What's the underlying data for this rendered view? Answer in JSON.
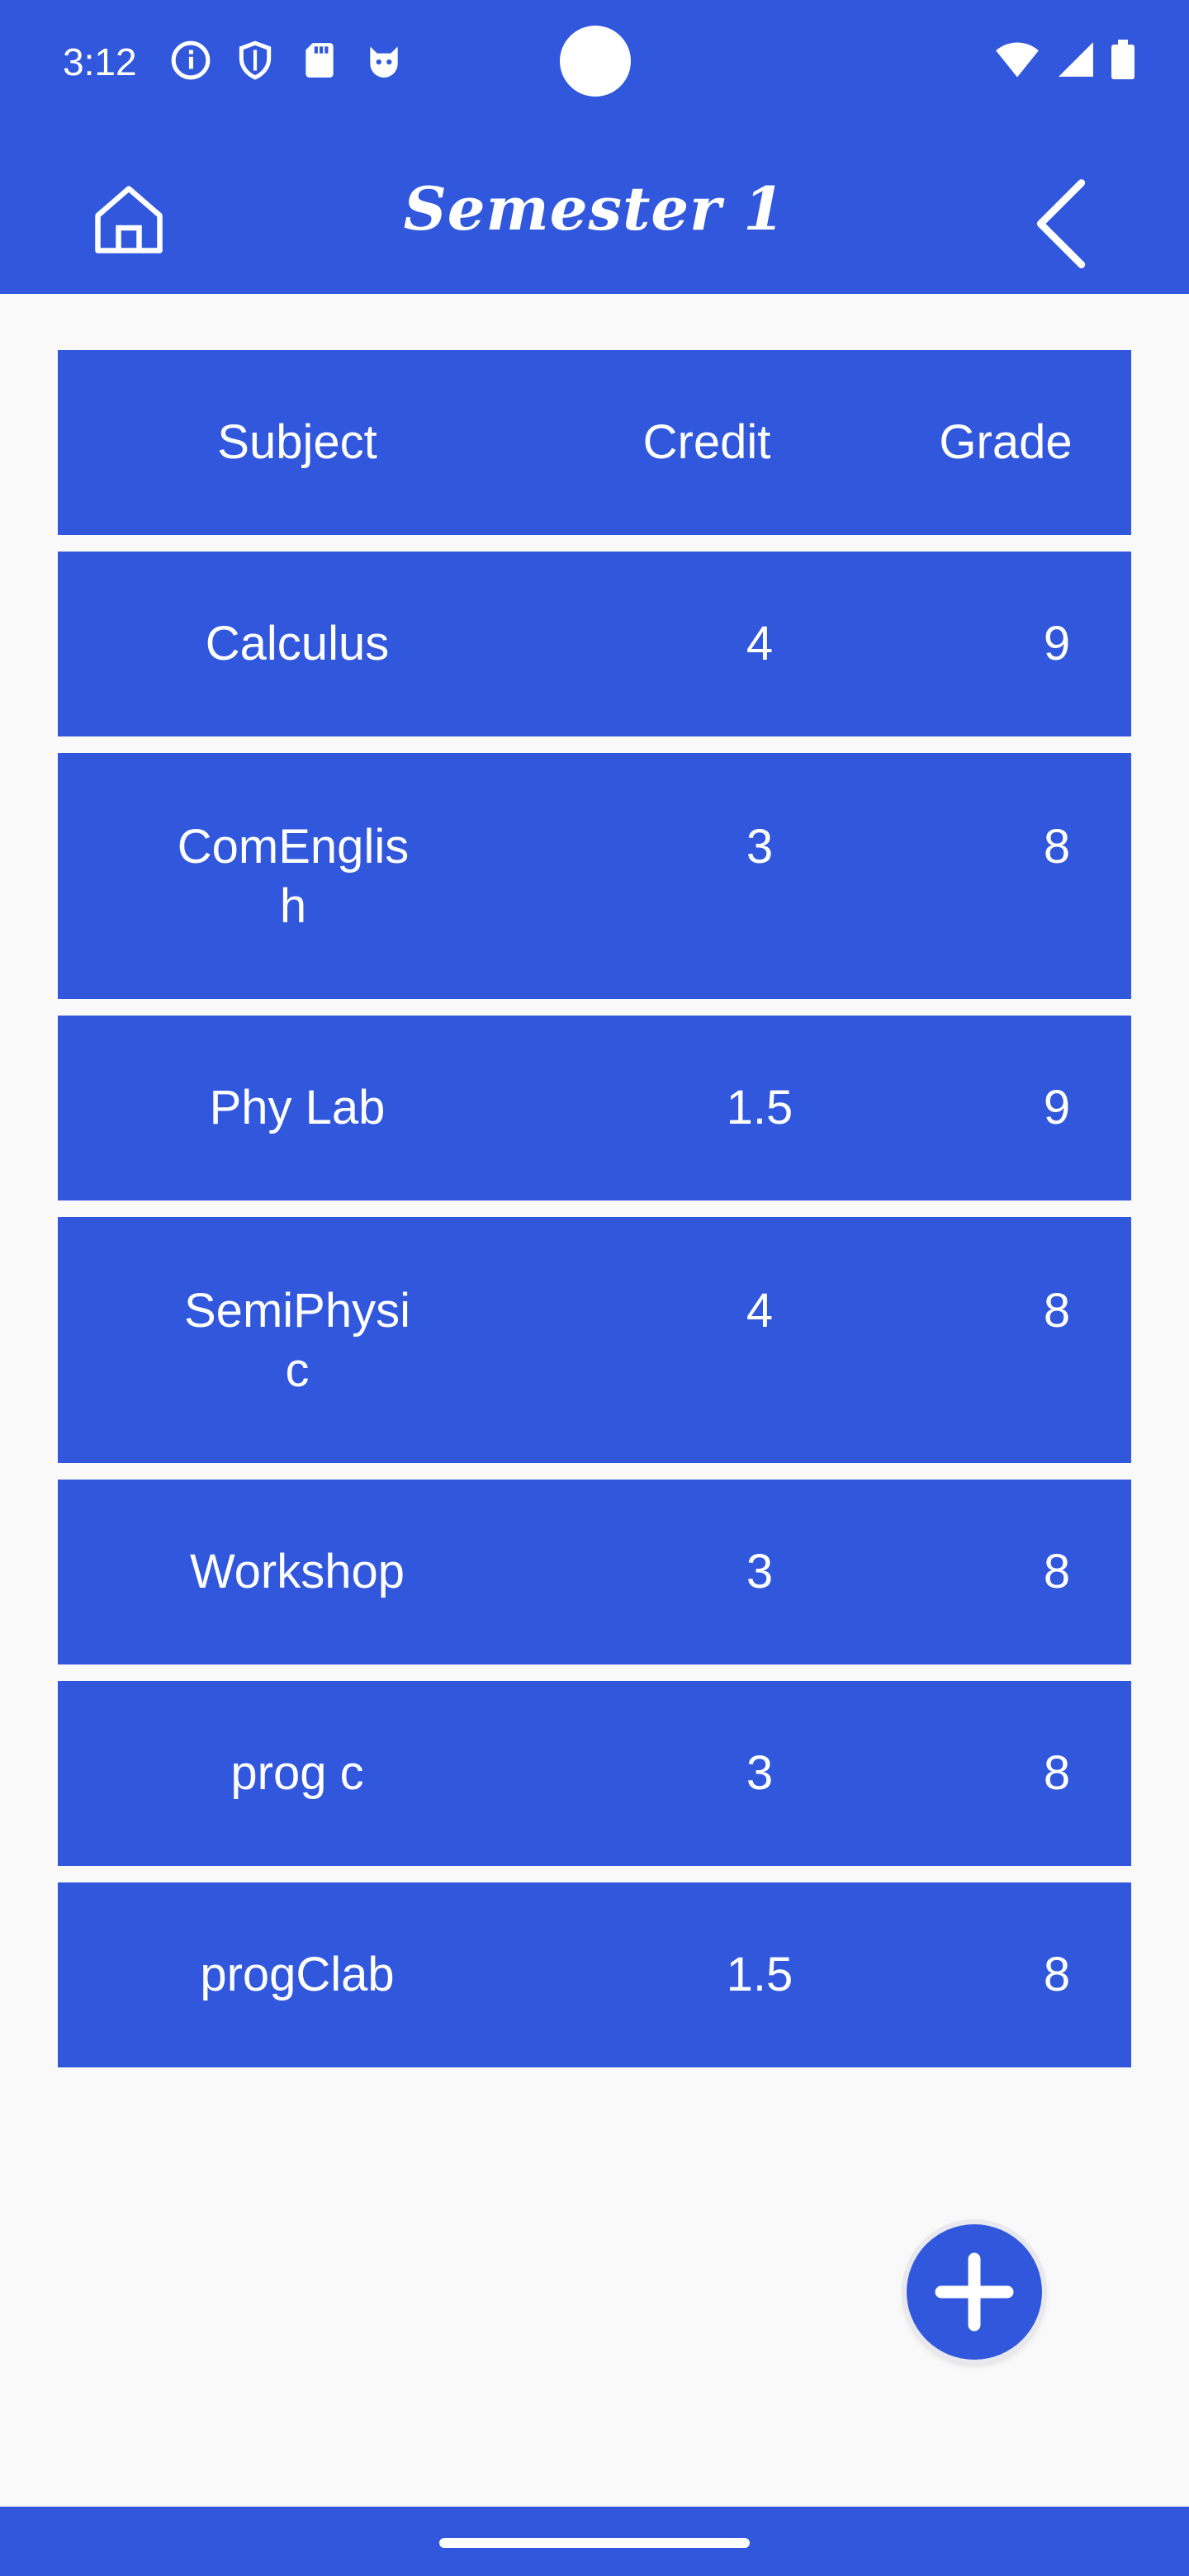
{
  "status_bar": {
    "time": "3:12",
    "left_icons": [
      "info-icon",
      "shield-icon",
      "sd-card-icon",
      "cat-face-icon"
    ],
    "right_icons": [
      "wifi-icon",
      "signal-icon",
      "battery-icon"
    ]
  },
  "app_bar": {
    "title": "Semester 1",
    "home_icon": "home-icon",
    "back_icon": "chevron-left-icon"
  },
  "table": {
    "headers": {
      "subject": "Subject",
      "credit": "Credit",
      "grade": "Grade"
    },
    "rows": [
      {
        "subject": "Calculus",
        "credit": "4",
        "grade": "9"
      },
      {
        "subject": "ComEnglish",
        "credit": "3",
        "grade": "8"
      },
      {
        "subject": "Phy Lab",
        "credit": "1.5",
        "grade": "9"
      },
      {
        "subject": "SemiPhysic",
        "credit": "4",
        "grade": "8"
      },
      {
        "subject": "Workshop",
        "credit": "3",
        "grade": "8"
      },
      {
        "subject": "prog c",
        "credit": "3",
        "grade": "8"
      },
      {
        "subject": "progClab",
        "credit": "1.5",
        "grade": "8"
      }
    ]
  },
  "fab": {
    "icon": "plus-icon"
  },
  "colors": {
    "primary": "#3158dc",
    "background": "#f9f9f9",
    "text": "#ffffff"
  }
}
